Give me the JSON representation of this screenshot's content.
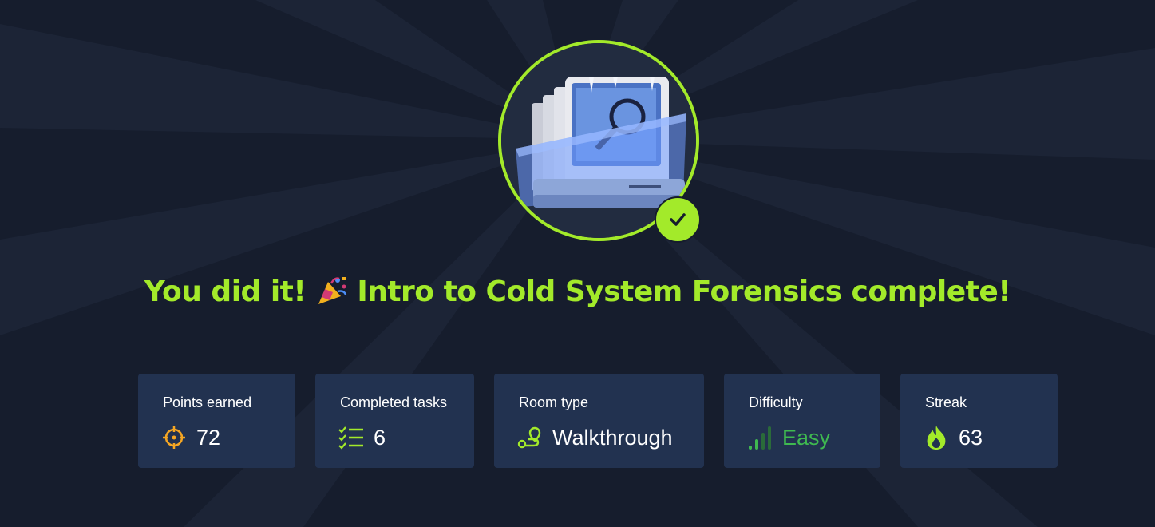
{
  "headline": {
    "before": "You did it!",
    "after": "Intro to Cold System Forensics complete!",
    "emoji_icon": "party-popper-icon"
  },
  "badge": {
    "image_icon": "frozen-computer-magnifier-icon",
    "status_icon": "check-icon"
  },
  "stats": {
    "points": {
      "label": "Points earned",
      "value": "72",
      "icon": "crosshair-icon"
    },
    "tasks": {
      "label": "Completed tasks",
      "value": "6",
      "icon": "checklist-icon"
    },
    "room_type": {
      "label": "Room type",
      "value": "Walkthrough",
      "icon": "route-icon"
    },
    "difficulty": {
      "label": "Difficulty",
      "value": "Easy",
      "icon": "signal-bars-icon"
    },
    "streak": {
      "label": "Streak",
      "value": "63",
      "icon": "flame-icon"
    }
  },
  "colors": {
    "background": "#161d2d",
    "accent": "#a3ea2a",
    "card": "#223250",
    "points_icon": "#f5a623",
    "easy": "#3fb950"
  }
}
